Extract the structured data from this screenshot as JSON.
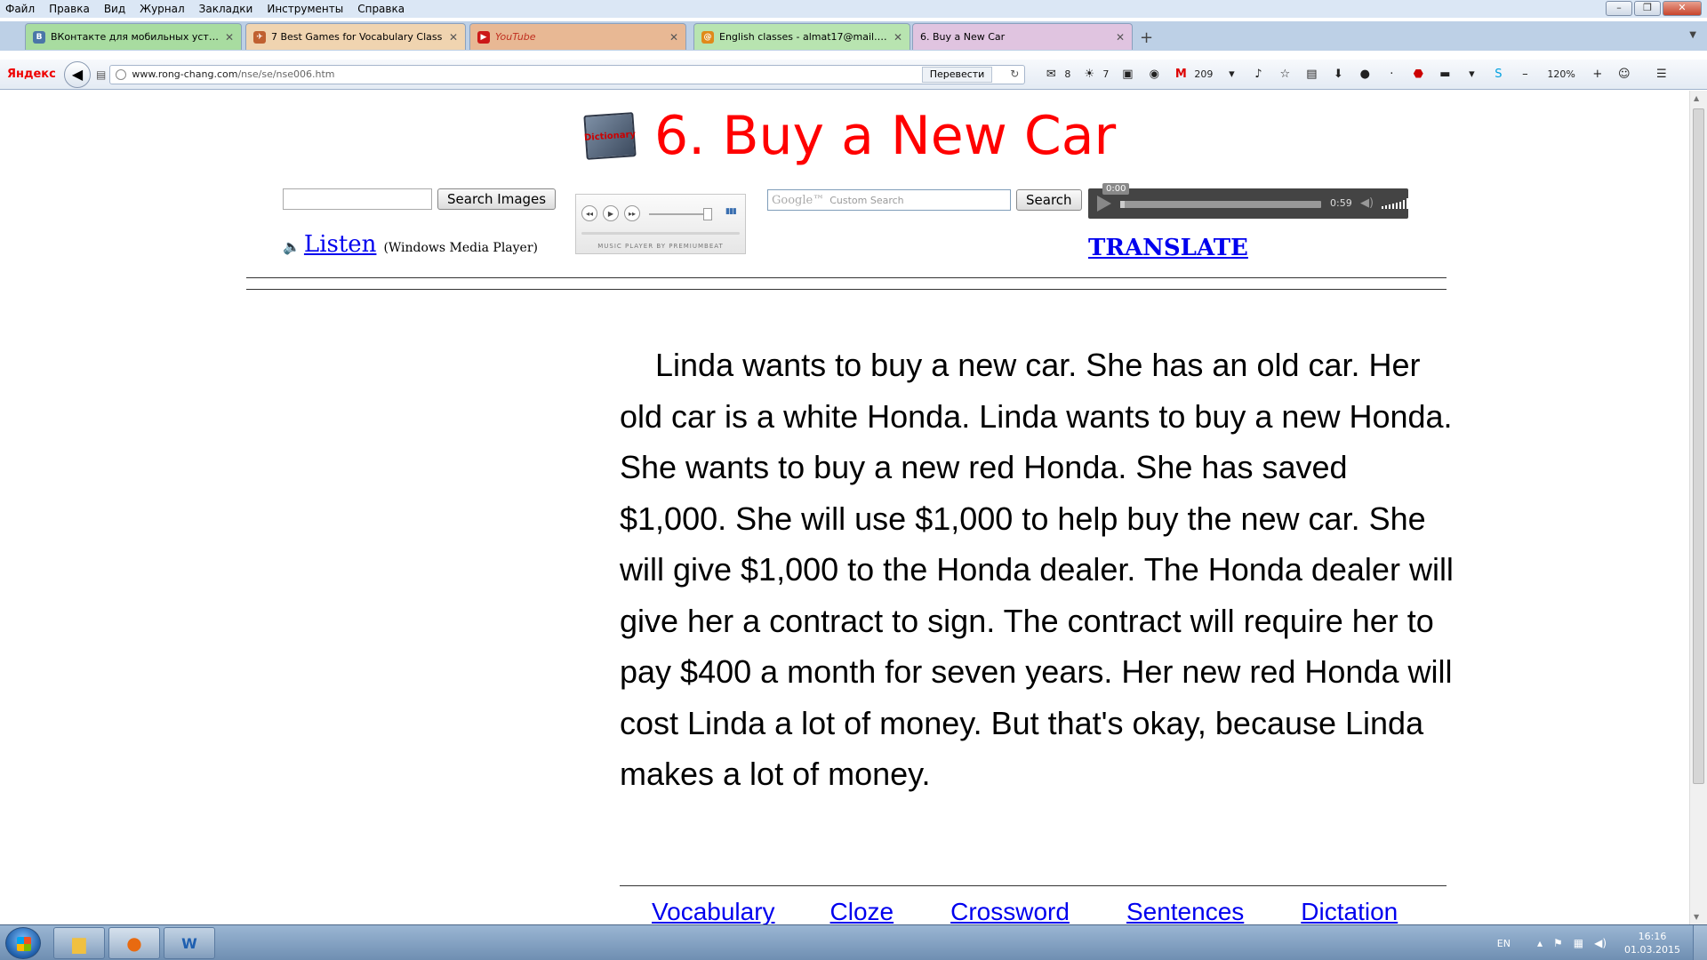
{
  "browser": {
    "menu": [
      "Файл",
      "Правка",
      "Вид",
      "Журнал",
      "Закладки",
      "Инструменты",
      "Справка"
    ],
    "tabs": [
      {
        "label": "ВКонтакте для мобильных устр...",
        "icon": "vk-icon",
        "icon_text": "В",
        "color": "#a8dca0",
        "icon_color": "#4a76a8"
      },
      {
        "label": "7 Best Games for Vocabulary Class",
        "icon": "bird-icon",
        "icon_text": "✈",
        "color": "#f0d4b0",
        "icon_color": "#c06030"
      },
      {
        "label": "YouTube",
        "icon": "youtube-icon",
        "icon_text": "▶",
        "color": "#e8b894",
        "icon_color": "#cc1818"
      },
      {
        "label": "English classes - almat17@mail.r...",
        "icon": "mail-icon",
        "icon_text": "@",
        "color": "#b8e4b0",
        "icon_color": "#e08a1a"
      },
      {
        "label": "6. Buy a New Car",
        "icon": "page-icon",
        "icon_text": "",
        "color": "#e0c4e0",
        "icon_color": "#e0c4e0"
      }
    ],
    "new_tab": "+",
    "yandex_logo": "Яндекс",
    "url_host": "www.rong-chang.com",
    "url_path": "/nse/se/nse006.htm",
    "translate_button": "Перевести",
    "toolbar": {
      "mail_count": "8",
      "weather_temp": "7",
      "gmail_count": "209",
      "zoom": "120%"
    }
  },
  "page": {
    "dict_icon_text": "Dictionary",
    "title": "6. Buy a New Car",
    "search_images_button": "Search Images",
    "listen_link": "Listen",
    "listen_player": "(Windows Media Player)",
    "music_player_credit": "MUSIC PLAYER BY PREMIUMBEAT",
    "google_search_brand": "Google™",
    "google_search_placeholder": "Custom Search",
    "search_button": "Search",
    "audio_current": "0:00",
    "audio_duration": "0:59",
    "audio_progress": 0.02,
    "translate_link": "TRANSLATE",
    "story": "Linda wants to buy a new car. She has an old car. Her old car is a white Honda. Linda wants to buy a new Honda. She wants to buy a new red Honda. She has saved $1,000. She will use $1,000 to help buy the new car. She will give $1,000 to the Honda dealer. The Honda dealer will give her a contract to sign. The contract will require her to pay $400 a month for seven years. Her new red Honda will cost Linda a lot of money. But that's okay, because Linda makes a lot of money.",
    "bottom_links": [
      "Vocabulary",
      "Cloze",
      "Crossword",
      "Sentences",
      "Dictation"
    ]
  },
  "taskbar": {
    "language": "EN",
    "time": "16:16",
    "date": "01.03.2015"
  }
}
